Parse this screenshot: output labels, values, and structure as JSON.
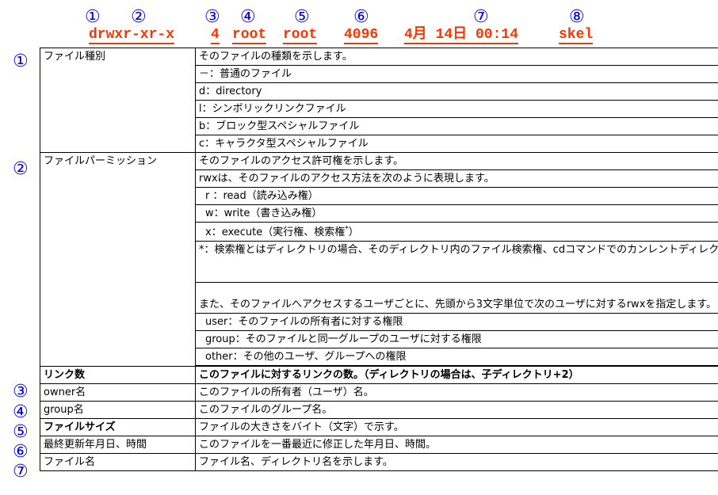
{
  "header": {
    "numbers": [
      "①",
      "②",
      "③",
      "④",
      "⑤",
      "⑥",
      "⑦",
      "⑧"
    ],
    "fields": [
      "drwxr-xr-x",
      "4",
      "root",
      "root",
      "4096",
      "4月 14日 00:14",
      "skel"
    ]
  },
  "rows": {
    "filetype": {
      "num": "①",
      "name": "ファイル種別",
      "lines": [
        "そのファイルの種類を示します。",
        "－：普通のファイル",
        "d：directory",
        "l：シンボリックリンクファイル",
        "b：ブロック型スペシャルファイル",
        "c：キャラクタ型スペシャルファイル"
      ]
    },
    "permission": {
      "num": "②",
      "name": "ファイルパーミッション",
      "lines": [
        "そのファイルのアクセス許可権を示します。",
        "rwxは、そのファイルのアクセス方法を次のように表現します。",
        "r ：read（読み込み権）",
        "w：write（書き込み権）",
        "x：execute（実行権、検索権",
        "*",
        "）",
        "*：検索権とはディレクトリの場合、そのディレクトリ内のファイル検索権、cdコマンドでのカンレントディレクトリの変更権、ls –lオプション実行時のファイル詳細情報の表示権を意味する。",
        "また、そのファイルへアクセスするユーザごとに、先頭から3文字単位で次のユーザに対するrwxを指定します。",
        "user：そのファイルの所有者に対する権限",
        "group：そのファイルと同一グループのユーザに対する権限",
        "other：その他のユーザ、グループへの権限"
      ]
    },
    "links": {
      "num": "③",
      "name": "リンク数",
      "desc": "このファイルに対するリンクの数。（ディレクトリの場合は、子ディレクトリ+2）"
    },
    "owner": {
      "num": "④",
      "name": "owner名",
      "desc": "このファイルの所有者（ユーザ）名。"
    },
    "group": {
      "num": "⑤",
      "name": "group名",
      "desc": "このファイルのグループ名。"
    },
    "size": {
      "num": "⑥",
      "name": "ファイルサイズ",
      "desc": "ファイルの大きさをバイト（文字）で示す。"
    },
    "mtime": {
      "num": "⑦",
      "name": "最終更新年月日、時間",
      "desc": "このファイルを一番最近に修正した年月日、時間。"
    },
    "filename": {
      "name": "ファイル名",
      "desc": "ファイル名、ディレクトリ名を示します。"
    }
  }
}
